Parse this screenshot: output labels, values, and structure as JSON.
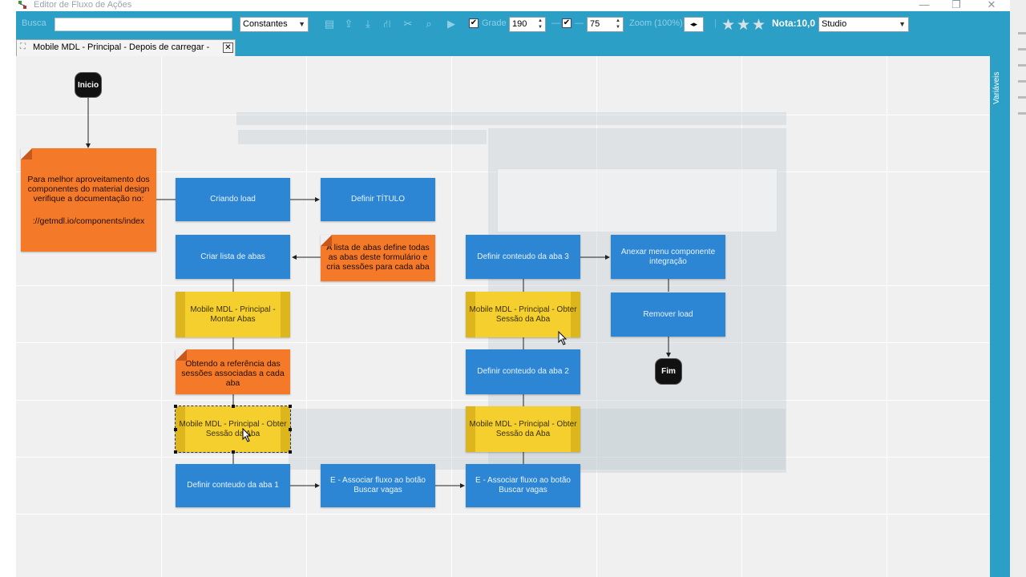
{
  "window": {
    "title": "Editor de Fluxo de Ações",
    "minimize": "—",
    "restore": "❐",
    "close": "✕"
  },
  "toolbar": {
    "search_label": "Busca",
    "search_value": "",
    "constants_select": "Constantes",
    "grid_label": "Grade",
    "grid_checked": true,
    "grid_value": "190",
    "second_checked": true,
    "second_value": "75",
    "zoom_label": "Zoom (100%)",
    "rating_stars": 3,
    "nota_label": "Nota:10,0",
    "profile_select": "Studio",
    "icons": [
      "new-file-icon",
      "export-icon",
      "import-icon",
      "hierarchy-icon",
      "scissors-icon",
      "search-flow-icon",
      "run-icon",
      "zoom-stepper-icon"
    ]
  },
  "tab": {
    "label": "Mobile MDL - Principal - Depois de carregar - Cliente",
    "close": "✕"
  },
  "rightbar": {
    "label": "Variáveis"
  },
  "flow": {
    "start": "Inicio",
    "end": "Fim",
    "note_top": {
      "text": "Para melhor aproveitamento dos componentes do material design verifique a documentação no:",
      "link": "://getmdl.io/components/index"
    },
    "criando_load": "Criando load",
    "definir_titulo": "Definir TÍTULO",
    "note_abas": "A lista de abas define todas as abas deste formulário e cria sessões para cada aba",
    "criar_lista": "Criar lista de abas",
    "montar_abas": "Mobile MDL - Principal - Montar Abas",
    "note_referencia": "Obtendo a referência das sessões associadas a cada aba",
    "obter_sessao_1": "Mobile MDL - Principal - Obter Sessão da Aba",
    "definir_aba_1": "Definir conteudo da aba 1",
    "associar_1": "E - Associar fluxo ao botão Buscar vagas",
    "associar_2": "E - Associar fluxo ao botão Buscar vagas",
    "obter_sessao_2": "Mobile MDL - Principal - Obter Sessão da Aba",
    "definir_aba_2": "Definir conteudo da aba 2",
    "obter_sessao_3": "Mobile MDL - Principal - Obter Sessão da Aba",
    "definir_aba_3": "Definir conteudo da aba 3",
    "anexar_menu": "Anexar menu componente integração",
    "remover_load": "Remover load"
  },
  "colors": {
    "toolbar": "#2b9fc6",
    "action_blue": "#2d86d4",
    "subflow_yellow": "#f4cf2e",
    "note_orange": "#f47a2a",
    "terminal": "#111111"
  }
}
